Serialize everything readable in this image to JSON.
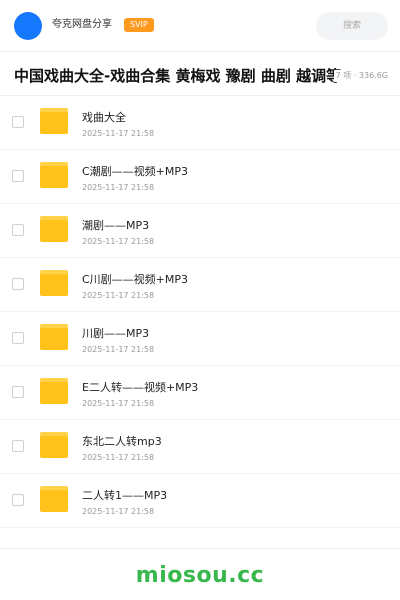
{
  "header": {
    "brand_name": "夸克网盘分享",
    "badge": "SVIP",
    "search_placeholder": "搜索"
  },
  "folder": {
    "title": "中国戏曲大全-戏曲合集 黄梅戏 豫剧 曲剧 越调等",
    "meta": "7 项 · 336.6G"
  },
  "items": [
    {
      "name": "戏曲大全",
      "date": "2025-11-17 21:58",
      "icon": "folder-icon"
    },
    {
      "name": "C潮剧——视频+MP3",
      "date": "2025-11-17 21:58",
      "icon": "folder-icon"
    },
    {
      "name": "潮剧——MP3",
      "date": "2025-11-17 21:58",
      "icon": "folder-icon"
    },
    {
      "name": "C川剧——视频+MP3",
      "date": "2025-11-17 21:58",
      "icon": "folder-icon"
    },
    {
      "name": "川剧——MP3",
      "date": "2025-11-17 21:58",
      "icon": "folder-icon"
    },
    {
      "name": "E二人转——视频+MP3",
      "date": "2025-11-17 21:58",
      "icon": "folder-icon"
    },
    {
      "name": "东北二人转mp3",
      "date": "2025-11-17 21:58",
      "icon": "folder-icon"
    },
    {
      "name": "二人转1——MP3",
      "date": "2025-11-17 21:58",
      "icon": "folder-icon"
    }
  ],
  "footer": {
    "watermark": "miosou.cc"
  },
  "colors": {
    "accent": "#1677ff",
    "badge": "#ff9a1f",
    "folder": "#ffc21a",
    "watermark": "#38b84c"
  }
}
